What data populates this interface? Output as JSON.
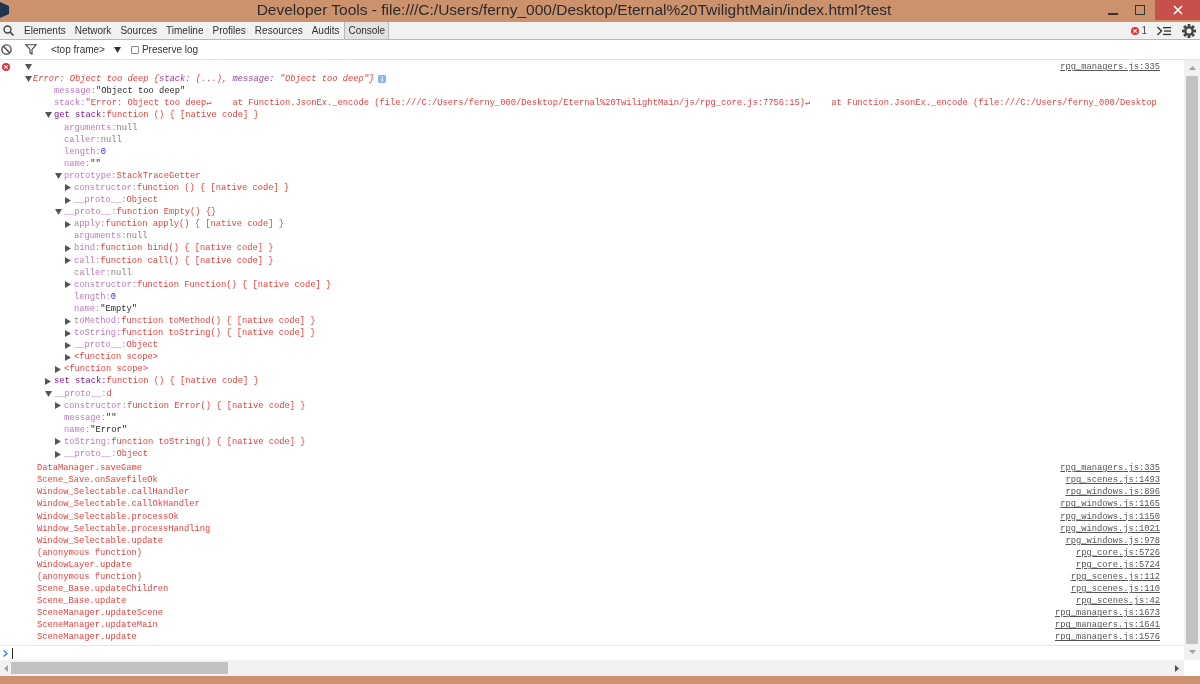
{
  "window": {
    "title": "Developer Tools - file:///C:/Users/ferny_000/Desktop/Eternal%20TwilightMain/index.html?test"
  },
  "tabs": [
    {
      "label": "Elements",
      "selected": false
    },
    {
      "label": "Network",
      "selected": false
    },
    {
      "label": "Sources",
      "selected": false
    },
    {
      "label": "Timeline",
      "selected": false
    },
    {
      "label": "Profiles",
      "selected": false
    },
    {
      "label": "Resources",
      "selected": false
    },
    {
      "label": "Audits",
      "selected": false
    },
    {
      "label": "Console",
      "selected": true
    }
  ],
  "error_count": "1",
  "console_toolbar": {
    "context": "<top frame>",
    "preserve_log": {
      "label": "Preserve log",
      "checked": false
    }
  },
  "messages": [
    {
      "kind": "error",
      "expanded": true,
      "source": "rpg_managers.js:335",
      "error": {
        "summary": [
          {
            "text": "Error: Object too deep {",
            "kind": "value"
          },
          {
            "text": "stack:",
            "kind": "key"
          },
          {
            "text": " (...), ",
            "kind": "value"
          },
          {
            "text": "message:",
            "kind": "key"
          },
          {
            "text": " \"Object too deep\"}",
            "kind": "value"
          }
        ],
        "expanded": true,
        "children": [
          {
            "kind": "string",
            "key": "message:",
            "value": "\"Object too deep\"",
            "dimmed": true
          },
          {
            "kind": "multiline",
            "key": "stack:",
            "value": "\"Error: Object too deep↵    at Function.JsonEx._encode (file:///C:/Users/ferny_000/Desktop/Eternal%20TwilightMain/js/rpg_core.js:7756:15)↵    at Function.JsonEx._encode (file:///C:/Users/ferny_000/Desktop",
            "dimmed": true
          },
          {
            "kind": "object",
            "key": "get stack:",
            "value": "function () { [native code] }",
            "dimmed": false,
            "expanded": true,
            "children": [
              {
                "kind": "null",
                "key": "arguments:",
                "value": "null",
                "dimmed": true
              },
              {
                "kind": "null",
                "key": "caller:",
                "value": "null",
                "dimmed": true
              },
              {
                "kind": "number",
                "key": "length:",
                "value": "0",
                "dimmed": true
              },
              {
                "kind": "string",
                "key": "name:",
                "value": "\"\"",
                "dimmed": true
              },
              {
                "kind": "object",
                "key": "prototype:",
                "value": "StackTraceGetter",
                "dimmed": true,
                "expanded": true,
                "children": [
                  {
                    "kind": "object",
                    "key": "constructor:",
                    "value": "function () { [native code] }",
                    "dimmed": true,
                    "expanded": false
                  },
                  {
                    "kind": "object",
                    "key": "__proto__:",
                    "value": "Object",
                    "dimmed": true,
                    "expanded": false
                  }
                ]
              },
              {
                "kind": "object",
                "key": "__proto__:",
                "value": "function Empty() {}",
                "dimmed": true,
                "expanded": true,
                "children": [
                  {
                    "kind": "object",
                    "key": "apply:",
                    "value": "function apply() { [native code] }",
                    "dimmed": true,
                    "expanded": false
                  },
                  {
                    "kind": "null",
                    "key": "arguments:",
                    "value": "null",
                    "dimmed": true
                  },
                  {
                    "kind": "object",
                    "key": "bind:",
                    "value": "function bind() { [native code] }",
                    "dimmed": true,
                    "expanded": false
                  },
                  {
                    "kind": "object",
                    "key": "call:",
                    "value": "function call() { [native code] }",
                    "dimmed": true,
                    "expanded": false
                  },
                  {
                    "kind": "null",
                    "key": "caller:",
                    "value": "null",
                    "dimmed": true
                  },
                  {
                    "kind": "object",
                    "key": "constructor:",
                    "value": "function Function() { [native code] }",
                    "dimmed": true,
                    "expanded": false
                  },
                  {
                    "kind": "number",
                    "key": "length:",
                    "value": "0",
                    "dimmed": true
                  },
                  {
                    "kind": "string",
                    "key": "name:",
                    "value": "\"Empty\"",
                    "dimmed": true
                  },
                  {
                    "kind": "object",
                    "key": "toMethod:",
                    "value": "function toMethod() { [native code] }",
                    "dimmed": true,
                    "expanded": false
                  },
                  {
                    "kind": "object",
                    "key": "toString:",
                    "value": "function toString() { [native code] }",
                    "dimmed": true,
                    "expanded": false
                  },
                  {
                    "kind": "object",
                    "key": "__proto__:",
                    "value": "Object",
                    "dimmed": true,
                    "expanded": false
                  },
                  {
                    "kind": "object",
                    "value": "<function scope>",
                    "expanded": false
                  }
                ]
              },
              {
                "kind": "object",
                "value": "<function scope>",
                "expanded": false
              }
            ]
          },
          {
            "kind": "object",
            "key": "set stack:",
            "value": "function () { [native code] }",
            "dimmed": false,
            "expanded": false
          },
          {
            "kind": "object",
            "key": "__proto__:",
            "value": "d",
            "dimmed": true,
            "expanded": true,
            "children": [
              {
                "kind": "object",
                "key": "constructor:",
                "value": "function Error() { [native code] }",
                "dimmed": true,
                "expanded": false
              },
              {
                "kind": "string",
                "key": "message:",
                "value": "\"\"",
                "dimmed": true
              },
              {
                "kind": "string",
                "key": "name:",
                "value": "\"Error\"",
                "dimmed": true
              },
              {
                "kind": "object",
                "key": "toString:",
                "value": "function toString() { [native code] }",
                "dimmed": true,
                "expanded": false
              },
              {
                "kind": "object",
                "key": "__proto__:",
                "value": "Object",
                "dimmed": true,
                "expanded": false
              }
            ]
          }
        ]
      },
      "stack_trace": [
        {
          "function": "DataManager.saveGame",
          "location": "rpg_managers.js:335"
        },
        {
          "function": "Scene_Save.onSavefileOk",
          "location": "rpg_scenes.js:1493"
        },
        {
          "function": "Window_Selectable.callHandler",
          "location": "rpg_windows.js:896"
        },
        {
          "function": "Window_Selectable.callOkHandler",
          "location": "rpg_windows.js:1165"
        },
        {
          "function": "Window_Selectable.processOk",
          "location": "rpg_windows.js:1150"
        },
        {
          "function": "Window_Selectable.processHandling",
          "location": "rpg_windows.js:1021"
        },
        {
          "function": "Window_Selectable.update",
          "location": "rpg_windows.js:978"
        },
        {
          "function": "(anonymous function)",
          "location": "rpg_core.js:5726"
        },
        {
          "function": "WindowLayer.update",
          "location": "rpg_core.js:5724"
        },
        {
          "function": "(anonymous function)",
          "location": "rpg_scenes.js:112"
        },
        {
          "function": "Scene_Base.updateChildren",
          "location": "rpg_scenes.js:110"
        },
        {
          "function": "Scene_Base.update",
          "location": "rpg_scenes.js:42"
        },
        {
          "function": "SceneManager.updateScene",
          "location": "rpg_managers.js:1673"
        },
        {
          "function": "SceneManager.updateMain",
          "location": "rpg_managers.js:1641"
        },
        {
          "function": "SceneManager.update",
          "location": "rpg_managers.js:1576"
        }
      ]
    }
  ]
}
